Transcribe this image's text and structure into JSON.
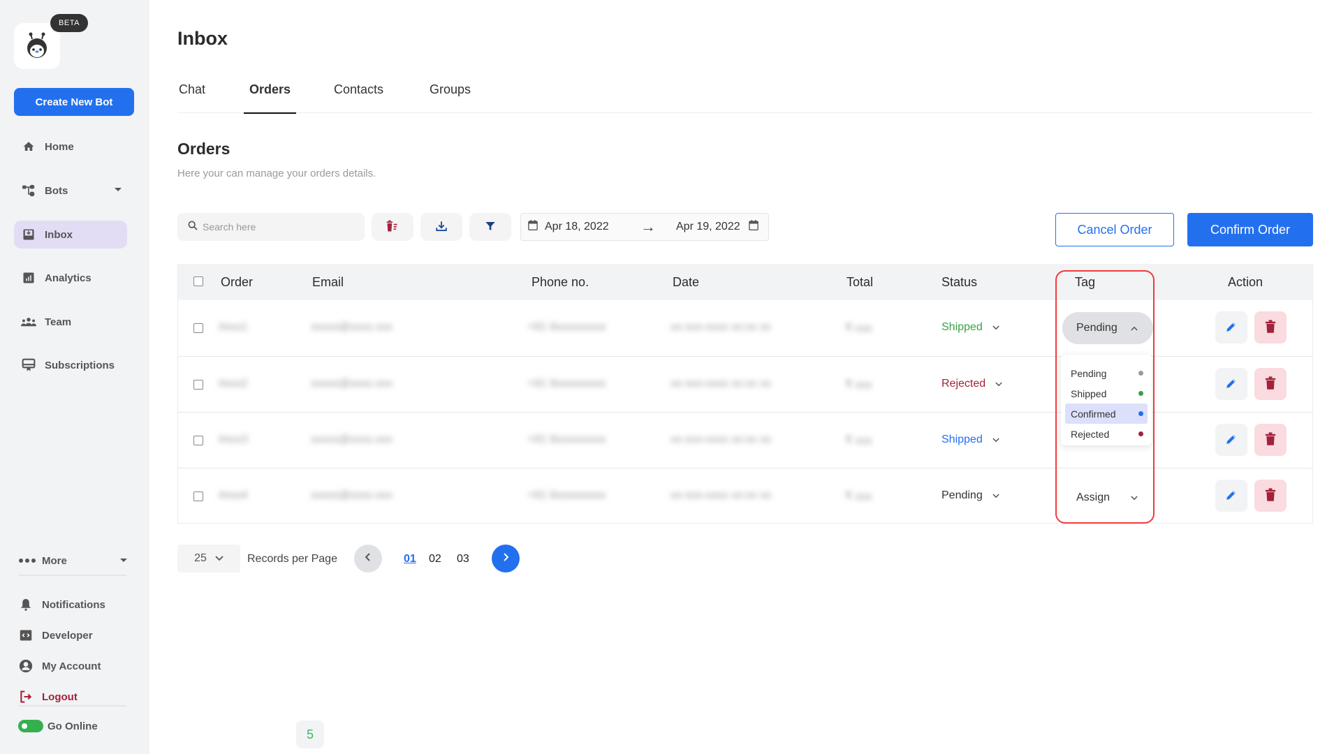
{
  "sidebar": {
    "beta_label": "BETA",
    "create_button": "Create New Bot",
    "nav": [
      {
        "label": "Home",
        "icon": "home-icon"
      },
      {
        "label": "Bots",
        "icon": "bots-icon",
        "has_caret": true
      },
      {
        "label": "Inbox",
        "icon": "inbox-icon",
        "active": true
      },
      {
        "label": "Analytics",
        "icon": "analytics-icon"
      },
      {
        "label": "Team",
        "icon": "team-icon"
      },
      {
        "label": "Subscriptions",
        "icon": "subscriptions-icon"
      }
    ],
    "more_label": "More",
    "bottom": [
      {
        "label": "Notifications",
        "icon": "bell-icon"
      },
      {
        "label": "Developer",
        "icon": "code-icon"
      },
      {
        "label": "My Account",
        "icon": "account-icon"
      },
      {
        "label": "Logout",
        "icon": "logout-icon"
      }
    ],
    "go_online_label": "Go Online",
    "go_online": true
  },
  "header": {
    "title": "Inbox",
    "tabs": [
      {
        "label": "Chat"
      },
      {
        "label": "Orders",
        "active": true
      },
      {
        "label": "Contacts"
      },
      {
        "label": "Groups"
      }
    ]
  },
  "section": {
    "title": "Orders",
    "subtitle": "Here your can manage your orders details."
  },
  "toolbar": {
    "search_placeholder": "Search here",
    "date_from": "Apr 18, 2022",
    "date_to": "Apr 19, 2022",
    "cancel_label": "Cancel Order",
    "confirm_label": "Confirm Order"
  },
  "table": {
    "columns": [
      "Order",
      "Email",
      "Phone no.",
      "Date",
      "Total",
      "Status",
      "Tag",
      "Action"
    ],
    "rows": [
      {
        "order": "#xxx1",
        "email": "xxxxx@xxxx.xxx",
        "phone": "+91 9xxxxxxxxx",
        "date": "xx-xxx-xxxx xx:xx xx",
        "total": "₹ xxx",
        "status": "Shipped",
        "status_color": "#3aa048",
        "tag": "Pending",
        "tag_open": true
      },
      {
        "order": "#xxx2",
        "email": "xxxxx@xxxx.xxx",
        "phone": "+91 9xxxxxxxxx",
        "date": "xx-xxx-xxxx xx:xx xx",
        "total": "₹ xxx",
        "status": "Rejected",
        "status_color": "#a3213a",
        "tag": ""
      },
      {
        "order": "#xxx3",
        "email": "xxxxx@xxxx.xxx",
        "phone": "+91 9xxxxxxxxx",
        "date": "xx-xxx-xxxx xx:xx xx",
        "total": "₹ xxx",
        "status": "Shipped",
        "status_color": "#2370ef",
        "tag": ""
      },
      {
        "order": "#xxx4",
        "email": "xxxxx@xxxx.xxx",
        "phone": "+91 9xxxxxxxxx",
        "date": "xx-xxx-xxxx xx:xx xx",
        "total": "₹ xxx",
        "status": "Pending",
        "status_color": "#333333",
        "tag": "Assign"
      }
    ]
  },
  "tag_dropdown": {
    "options": [
      {
        "label": "Pending",
        "color": "#9a9a9a"
      },
      {
        "label": "Shipped",
        "color": "#3aa048"
      },
      {
        "label": "Confirmed",
        "color": "#2370ef",
        "highlighted": true
      },
      {
        "label": "Rejected",
        "color": "#a3213a"
      }
    ]
  },
  "pagination": {
    "per_page": "25",
    "per_page_label": "Records per Page",
    "pages": [
      "01",
      "02",
      "03"
    ],
    "current": "01"
  },
  "badge_count": "5",
  "colors": {
    "accent": "#2370ef",
    "danger": "#a3213a",
    "success": "#3aa048",
    "highlight": "#f23a3a"
  }
}
